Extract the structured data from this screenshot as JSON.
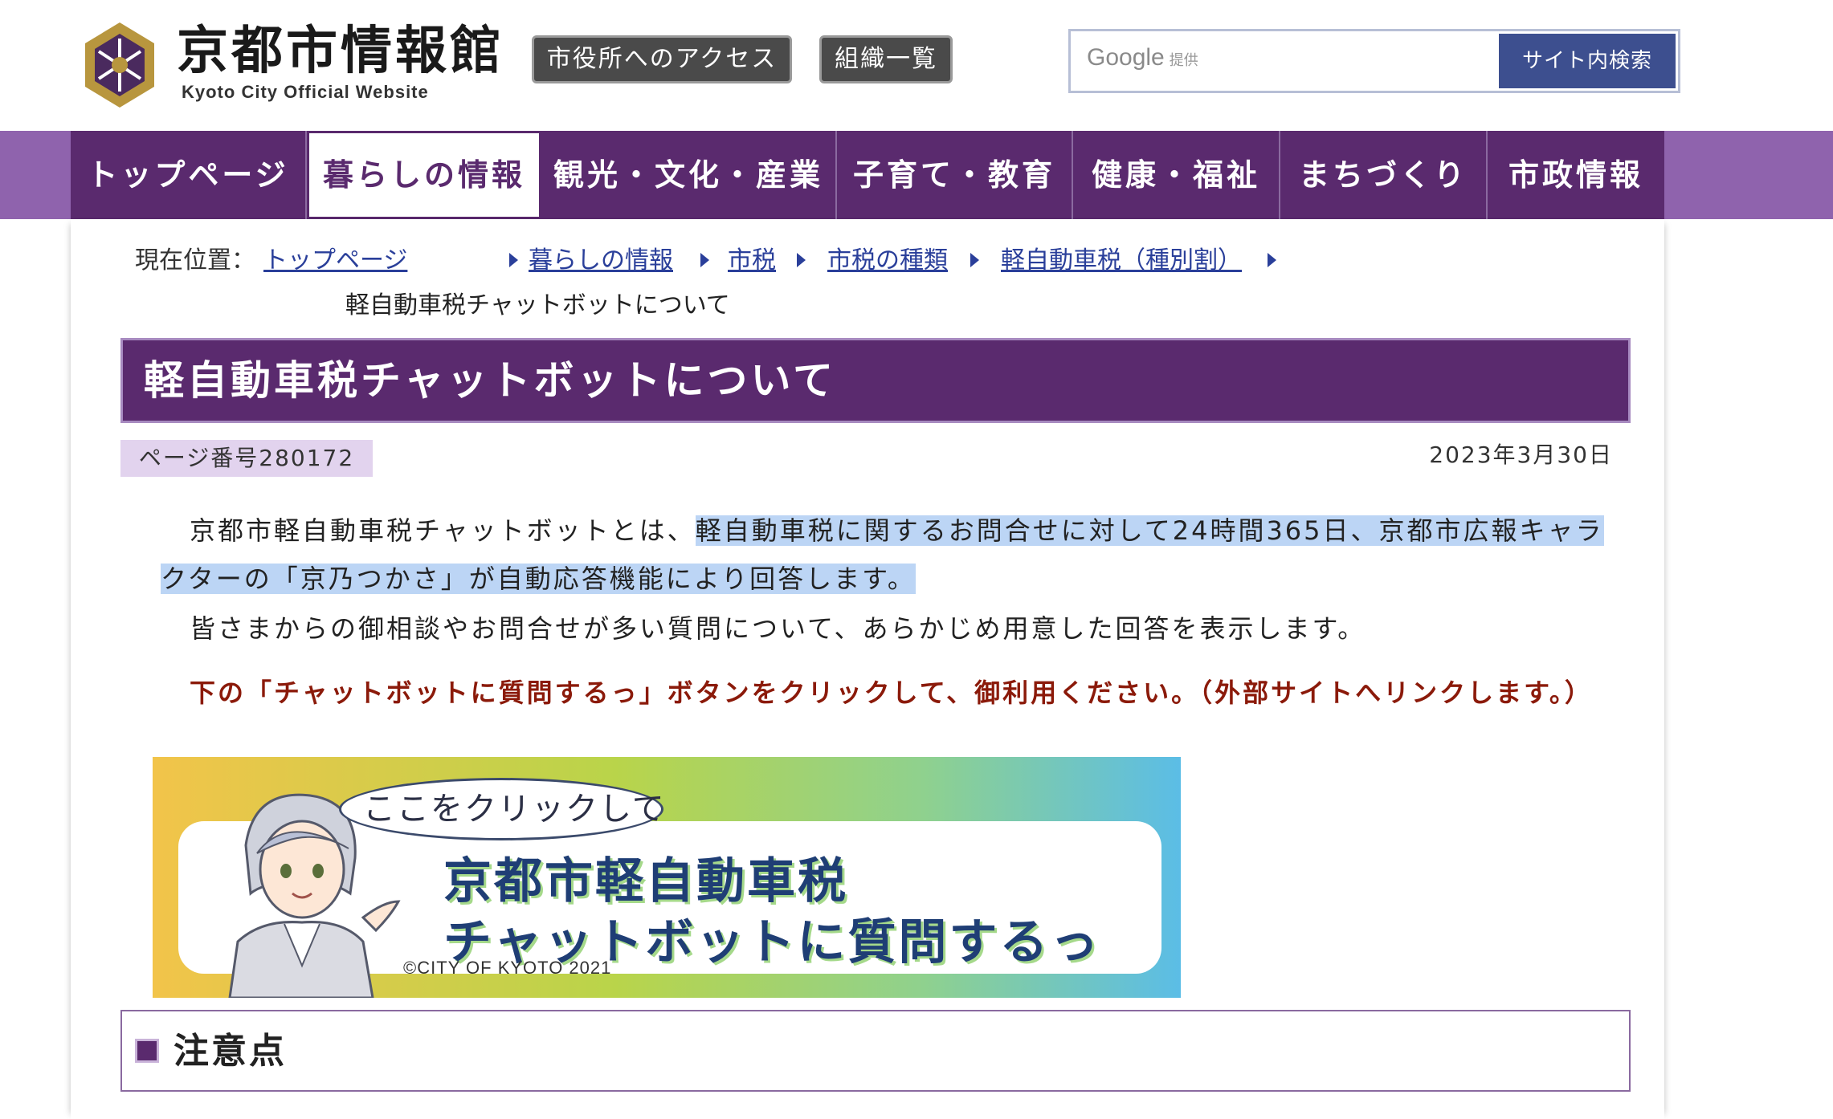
{
  "header": {
    "site_title": "京都市情報館",
    "site_subtitle": "Kyoto City Official Website",
    "access_button": "市役所へのアクセス",
    "org_button": "組織一覧",
    "search": {
      "placeholder": "",
      "provider": "Google",
      "provider_note": "提供",
      "button": "サイト内検索"
    }
  },
  "nav": {
    "items": [
      {
        "label": "トップページ"
      },
      {
        "label": "暮らしの情報"
      },
      {
        "label": "観光・文化・産業"
      },
      {
        "label": "子育て・教育"
      },
      {
        "label": "健康・福祉"
      },
      {
        "label": "まちづくり"
      },
      {
        "label": "市政情報"
      }
    ],
    "active_index": 1
  },
  "breadcrumb": {
    "label": "現在位置：",
    "links": [
      "トップページ",
      "暮らしの情報",
      "市税",
      "市税の種類",
      "軽自動車税（種別割）"
    ],
    "current": "軽自動車税チャットボットについて"
  },
  "page": {
    "title": "軽自動車税チャットボットについて",
    "page_number": "ページ番号280172",
    "date": "2023年3月30日",
    "para1_plain": "京都市軽自動車税チャットボットとは、",
    "para1_highlight_a": "軽自動車税に関するお問合せに対して24時間365日、京都市広報キャラ",
    "para1_highlight_b": "クターの「京乃つかさ」が自動応答機能により回答します。",
    "para2": "皆さまからの御相談やお問合せが多い質問について、あらかじめ用意した回答を表示します。",
    "note": "下の「チャットボットに質問するっ」ボタンをクリックして、御利用ください。（外部サイトへリンクします。）"
  },
  "banner": {
    "bubble": "ここをクリックして",
    "line1": "京都市軽自動車税",
    "line2": "チャットボットに質問するっ",
    "copyright": "©CITY OF KYOTO 2021"
  },
  "section": {
    "heading": "注意点"
  },
  "colors": {
    "brand_purple": "#5a2a6e",
    "nav_outer": "#8f63ad",
    "link_blue": "#2a3f9a",
    "note_red": "#8b1a0a",
    "highlight": "#bcd5f5",
    "search_button": "#3d4f8f"
  },
  "icons": [
    "kyoto-emblem-icon",
    "breadcrumb-arrow-icon",
    "section-square-icon"
  ]
}
